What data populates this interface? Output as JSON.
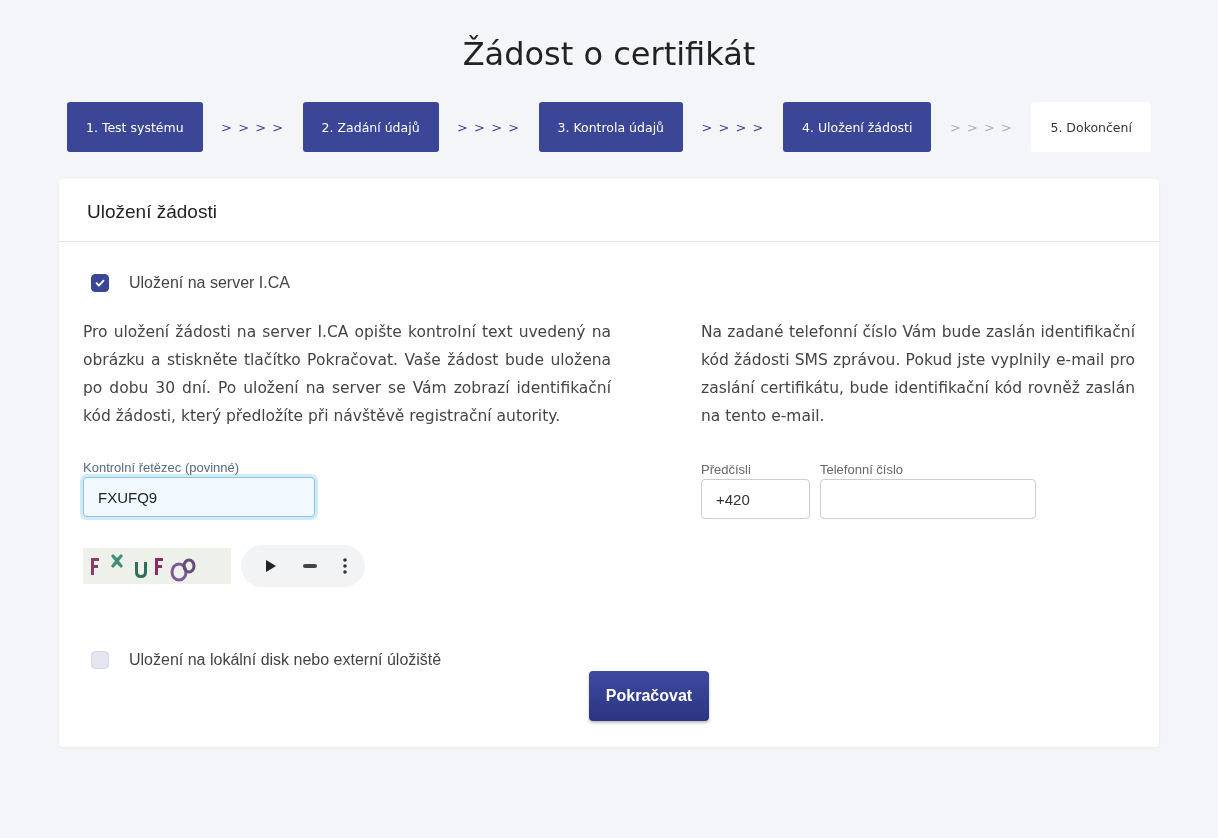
{
  "title": "Žádost o certifikát",
  "steps": [
    {
      "label": "1. Test systému",
      "done": true,
      "separator": "> > > >"
    },
    {
      "label": "2. Zadání údajů",
      "done": true,
      "separator": "> > > >"
    },
    {
      "label": "3. Kontrola údajů",
      "done": true,
      "separator": "> > > >"
    },
    {
      "label": "4. Uložení žádosti",
      "done": true,
      "separator": "> > > >"
    },
    {
      "label": "5. Dokončení",
      "done": false
    }
  ],
  "card": {
    "heading": "Uložení žádosti",
    "server_option": {
      "label": "Uložení na server I.CA",
      "checked": true
    },
    "server_text": "Pro uložení žádosti na server I.CA opište kontrolní text uvedený na obrázku a stiskněte tlačítko Pokračovat. Vaše žádost bude uložena po dobu 30 dní. Po uložení na server se Vám zobrazí identifikační kód žádosti, který předložíte při návštěvě registrační autority.",
    "captcha_field": {
      "label": "Kontrolní řetězec (povinné)",
      "value": "FXUFQ9"
    },
    "sms_text": "Na zadané telefonní číslo Vám bude zaslán identifikační kód žádosti SMS zprávou. Pokud jste vyplnily e-mail pro zaslání certifikátu, bude identifikační kód rovněž zaslán na tento e-mail.",
    "prefix_field": {
      "label": "Předčísli",
      "value": "+420"
    },
    "phone_field": {
      "label": "Telefonní číslo"
    },
    "local_option": {
      "label": "Uložení na lokální disk nebo externí úložiště",
      "checked": false
    },
    "submit": "Pokračovat"
  }
}
